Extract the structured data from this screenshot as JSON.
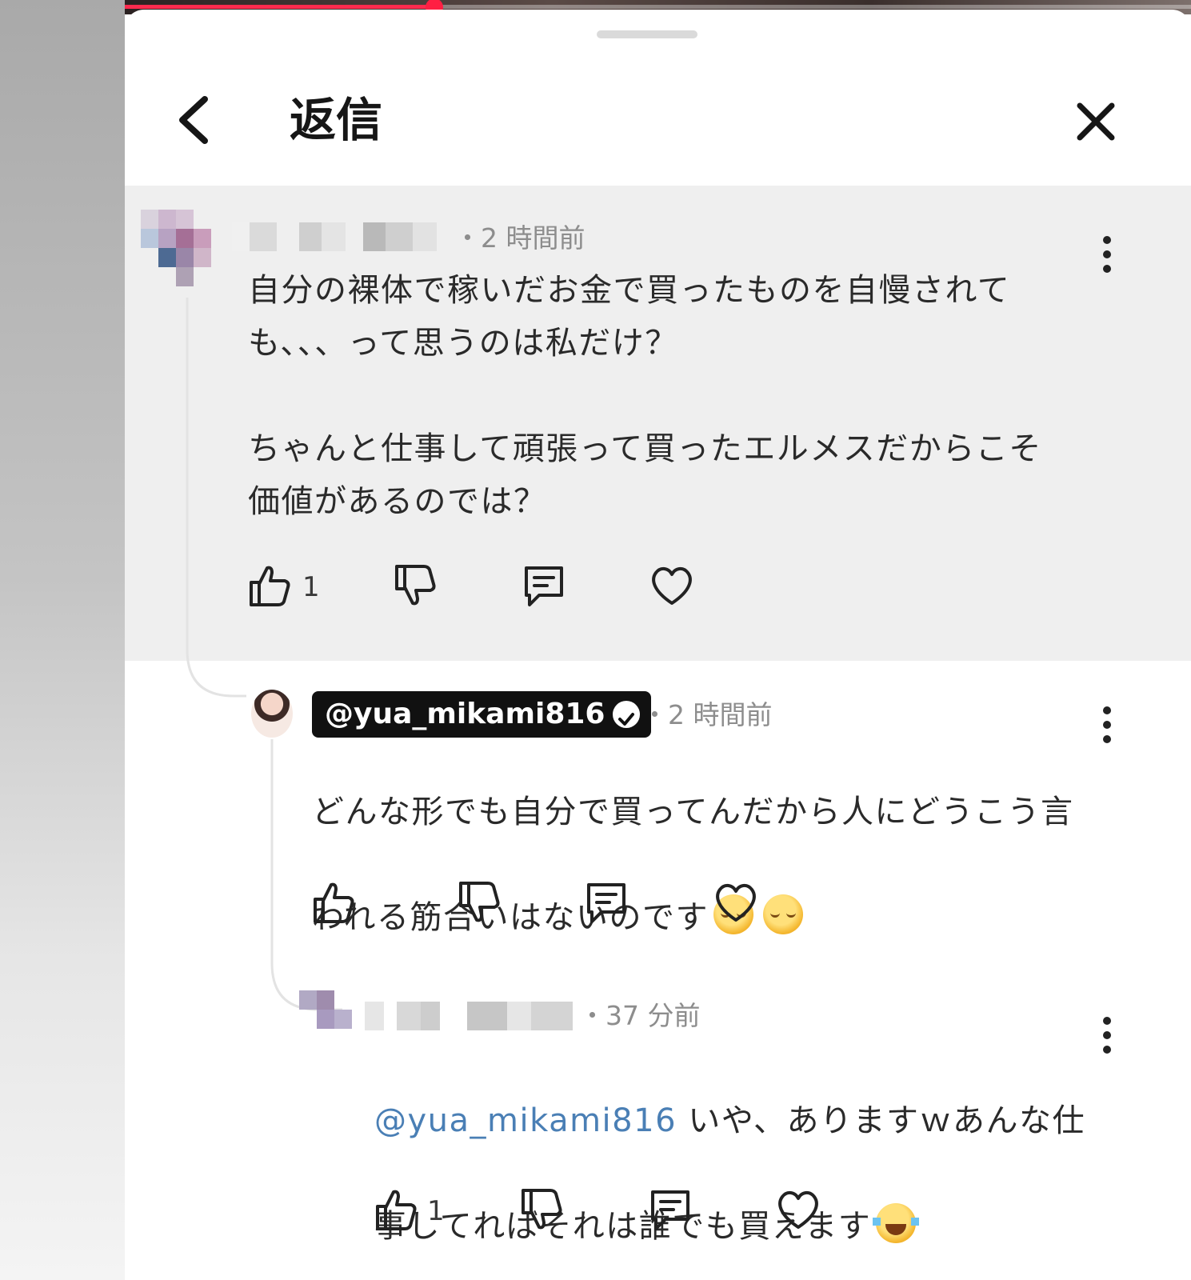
{
  "header": {
    "title": "返信"
  },
  "video": {
    "progress_fraction": 0.29
  },
  "comments": [
    {
      "time": "・2 時間前",
      "text": "自分の裸体で稼いだお金で買ったものを自慢されて\nも、、、って思うのは私だけ？\n\nちゃんと仕事して頑張って買ったエルメスだからこそ\n価値があるのでは？",
      "like_count": "1"
    },
    {
      "username": "@yua_mikami816",
      "time": "・2 時間前",
      "text_line1": "どんな形でも自分で買ってんだから人にどうこう言",
      "text_line2": "われる筋合いはないのです",
      "emoji": [
        "relieved-face-icon",
        "relieved-face-icon"
      ]
    },
    {
      "time": "・37 分前",
      "mention": "@yua_mikami816",
      "text_line1": " いや、ありますｗあんな仕",
      "text_line2": "事してればそれは誰でも買えます",
      "emoji": [
        "face-with-tears-of-joy-icon"
      ],
      "like_count": "1"
    }
  ],
  "colors": {
    "accent_red": "#ff1f43",
    "mention_blue": "#4a7fb5",
    "highlight_bg": "#efefef"
  }
}
